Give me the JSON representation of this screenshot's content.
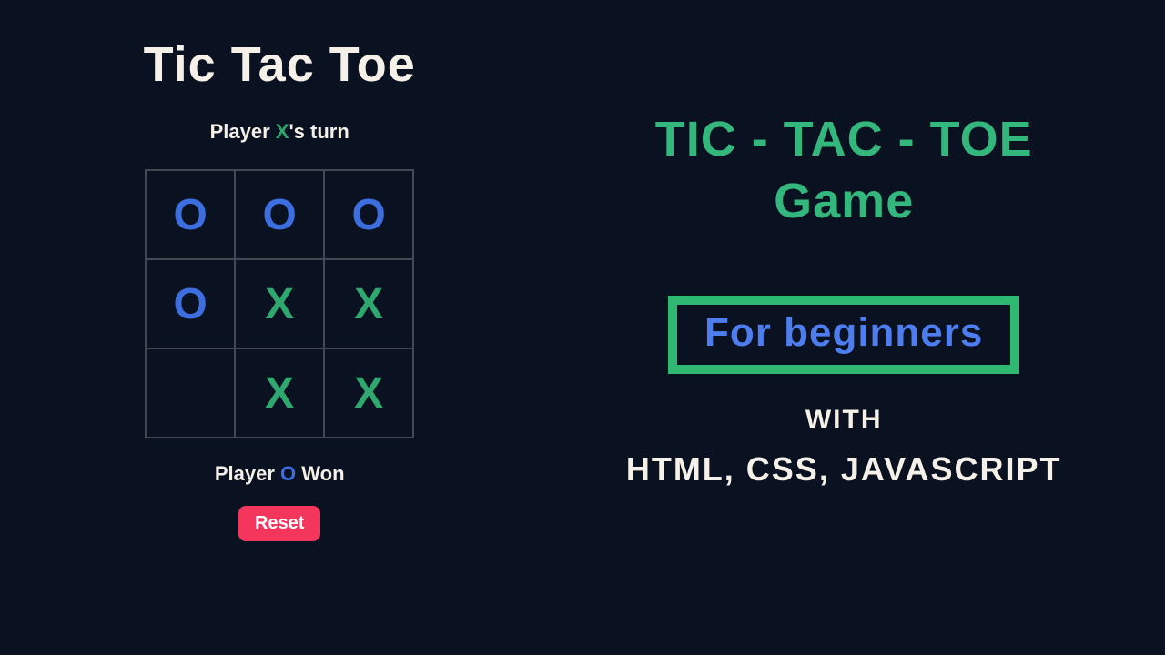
{
  "game": {
    "title": "Tic Tac Toe",
    "turn_prefix": "Player ",
    "turn_player": "X",
    "turn_suffix": "'s turn",
    "board": [
      "O",
      "O",
      "O",
      "O",
      "X",
      "X",
      "",
      "X",
      "X"
    ],
    "status_prefix": "Player ",
    "status_player": "O",
    "status_suffix": " Won",
    "reset_label": "Reset"
  },
  "promo": {
    "title_line1": "TIC - TAC - TOE",
    "title_line2": "Game",
    "badge": "For beginners",
    "with": "WITH",
    "tech": "HTML, CSS, JAVASCRIPT"
  }
}
